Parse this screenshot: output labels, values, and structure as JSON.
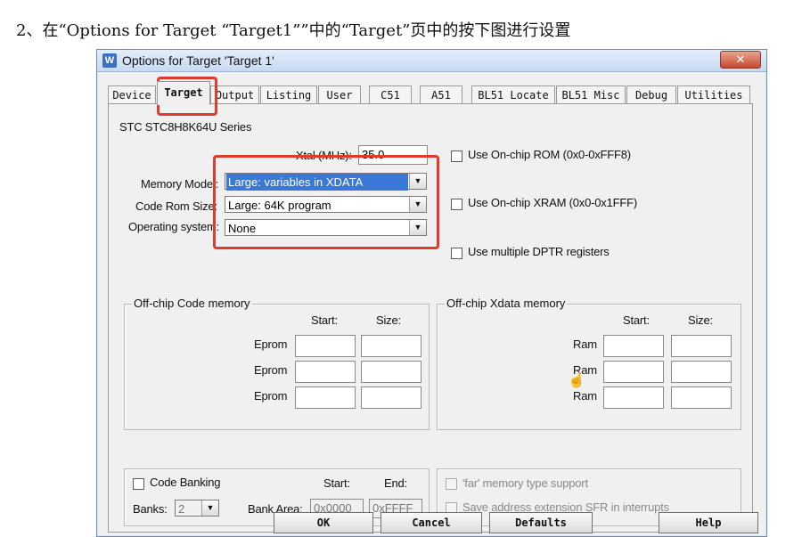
{
  "heading": "2、在“Options for Target “Target1””中的“Target”页中的按下图进行设置",
  "dialog": {
    "icon_glyph": "W",
    "title": "Options for Target 'Target 1'",
    "close_glyph": "✕"
  },
  "tabs": [
    "Device",
    "Target",
    "Output",
    "Listing",
    "User",
    "C51",
    "A51",
    "BL51 Locate",
    "BL51 Misc",
    "Debug",
    "Utilities"
  ],
  "active_tab": "Target",
  "target": {
    "chip": "STC STC8H8K64U Series",
    "xtal_label": "Xtal (MHz):",
    "xtal_value": "35.0",
    "memory_model_label": "Memory Model:",
    "memory_model_value": "Large: variables in XDATA",
    "code_rom_label": "Code Rom Size:",
    "code_rom_value": "Large: 64K program",
    "os_label": "Operating system:",
    "os_value": "None",
    "use_onchip_rom": "Use On-chip ROM (0x0-0xFFF8)",
    "use_onchip_xram": "Use On-chip XRAM (0x0-0x1FFF)",
    "use_multi_dptr": "Use multiple DPTR registers"
  },
  "offchip_code": {
    "legend": "Off-chip Code memory",
    "start_header": "Start:",
    "size_header": "Size:",
    "rows": [
      "Eprom",
      "Eprom",
      "Eprom"
    ]
  },
  "offchip_xdata": {
    "legend": "Off-chip Xdata memory",
    "start_header": "Start:",
    "size_header": "Size:",
    "rows": [
      "Ram",
      "Ram",
      "Ram"
    ]
  },
  "banking": {
    "code_banking_label": "Code Banking",
    "start_header": "Start:",
    "end_header": "End:",
    "banks_label": "Banks:",
    "banks_value": "2",
    "bank_area_label": "Bank Area:",
    "bank_area_start": "0x0000",
    "bank_area_end": "0xFFFF"
  },
  "options": {
    "far_memory": "'far' memory type support",
    "save_address": "Save address extension SFR in interrupts"
  },
  "buttons": {
    "ok": "OK",
    "cancel": "Cancel",
    "defaults": "Defaults",
    "help": "Help"
  },
  "colors": {
    "highlight_red": "#e03a2f",
    "selection_blue": "#3a78d8"
  }
}
